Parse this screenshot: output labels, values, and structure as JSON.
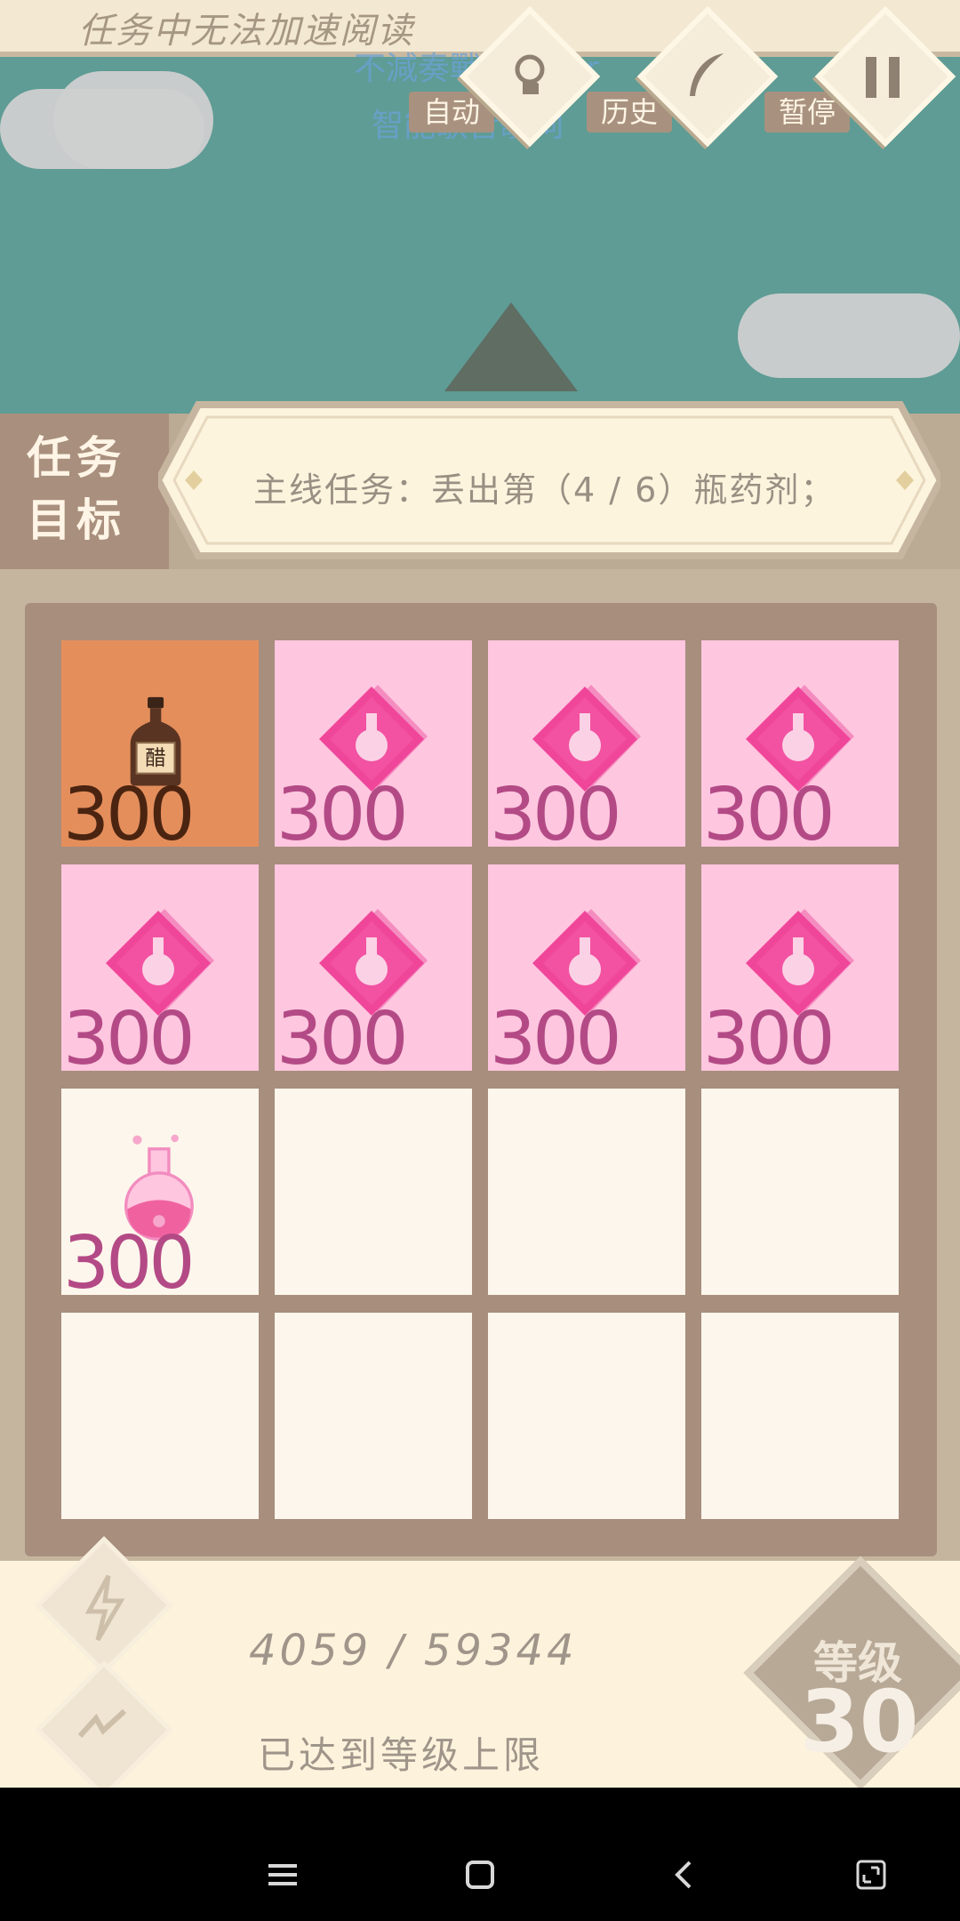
{
  "banner": {
    "text": "任务中无法加速阅读"
  },
  "watermark": {
    "line1": "不減奏戰 - ether",
    "line2": "智能歌音歌词"
  },
  "controls": {
    "auto_label": "自动",
    "history_label": "历史",
    "pause_label": "暂停"
  },
  "task": {
    "label_line1": "任务",
    "label_line2": "目标",
    "text": "主线任务：丢出第（4 / 6）瓶药剂；"
  },
  "board": {
    "rows": [
      [
        {
          "type": "vinegar",
          "value": "300",
          "bottle_label": "醋"
        },
        {
          "type": "gem",
          "value": "300"
        },
        {
          "type": "gem",
          "value": "300"
        },
        {
          "type": "gem",
          "value": "300"
        }
      ],
      [
        {
          "type": "gem",
          "value": "300"
        },
        {
          "type": "gem",
          "value": "300"
        },
        {
          "type": "gem",
          "value": "300"
        },
        {
          "type": "gem",
          "value": "300"
        }
      ],
      [
        {
          "type": "potion",
          "value": "300"
        },
        {
          "type": "empty",
          "value": ""
        },
        {
          "type": "empty",
          "value": ""
        },
        {
          "type": "empty",
          "value": ""
        }
      ],
      [
        {
          "type": "empty",
          "value": ""
        },
        {
          "type": "empty",
          "value": ""
        },
        {
          "type": "empty",
          "value": ""
        },
        {
          "type": "empty",
          "value": ""
        }
      ]
    ]
  },
  "footer": {
    "progress": "4059 / 59344",
    "max_level_text": "已达到等级上限",
    "level_label": "等级",
    "level_value": "30"
  },
  "colors": {
    "sky": "#5e9c95",
    "pink_cell": "#ffc6df",
    "gem": "#f0469a",
    "orange_cell": "#e48e5c"
  }
}
